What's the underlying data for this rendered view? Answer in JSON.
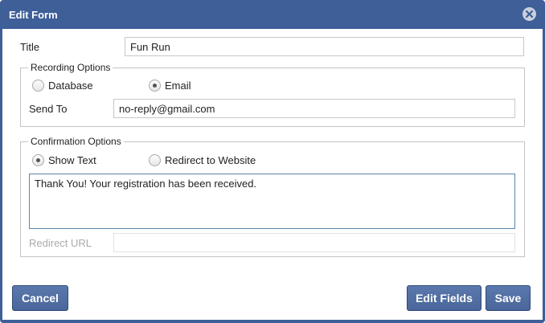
{
  "dialog": {
    "title": "Edit Form",
    "close_icon": "close-circle-icon"
  },
  "form": {
    "title_label": "Title",
    "title_value": "Fun Run"
  },
  "recording": {
    "legend": "Recording Options",
    "options": [
      {
        "label": "Database",
        "selected": false
      },
      {
        "label": "Email",
        "selected": true
      }
    ],
    "send_to_label": "Send To",
    "send_to_value": "no-reply@gmail.com"
  },
  "confirmation": {
    "legend": "Confirmation Options",
    "options": [
      {
        "label": "Show Text",
        "selected": true
      },
      {
        "label": "Redirect to Website",
        "selected": false
      }
    ],
    "message": "Thank You! Your registration has been received.",
    "redirect_label": "Redirect URL",
    "redirect_value": ""
  },
  "buttons": {
    "cancel": "Cancel",
    "edit_fields": "Edit Fields",
    "save": "Save"
  },
  "colors": {
    "titlebar": "#3e5f98",
    "button": "#4e6ca0"
  }
}
